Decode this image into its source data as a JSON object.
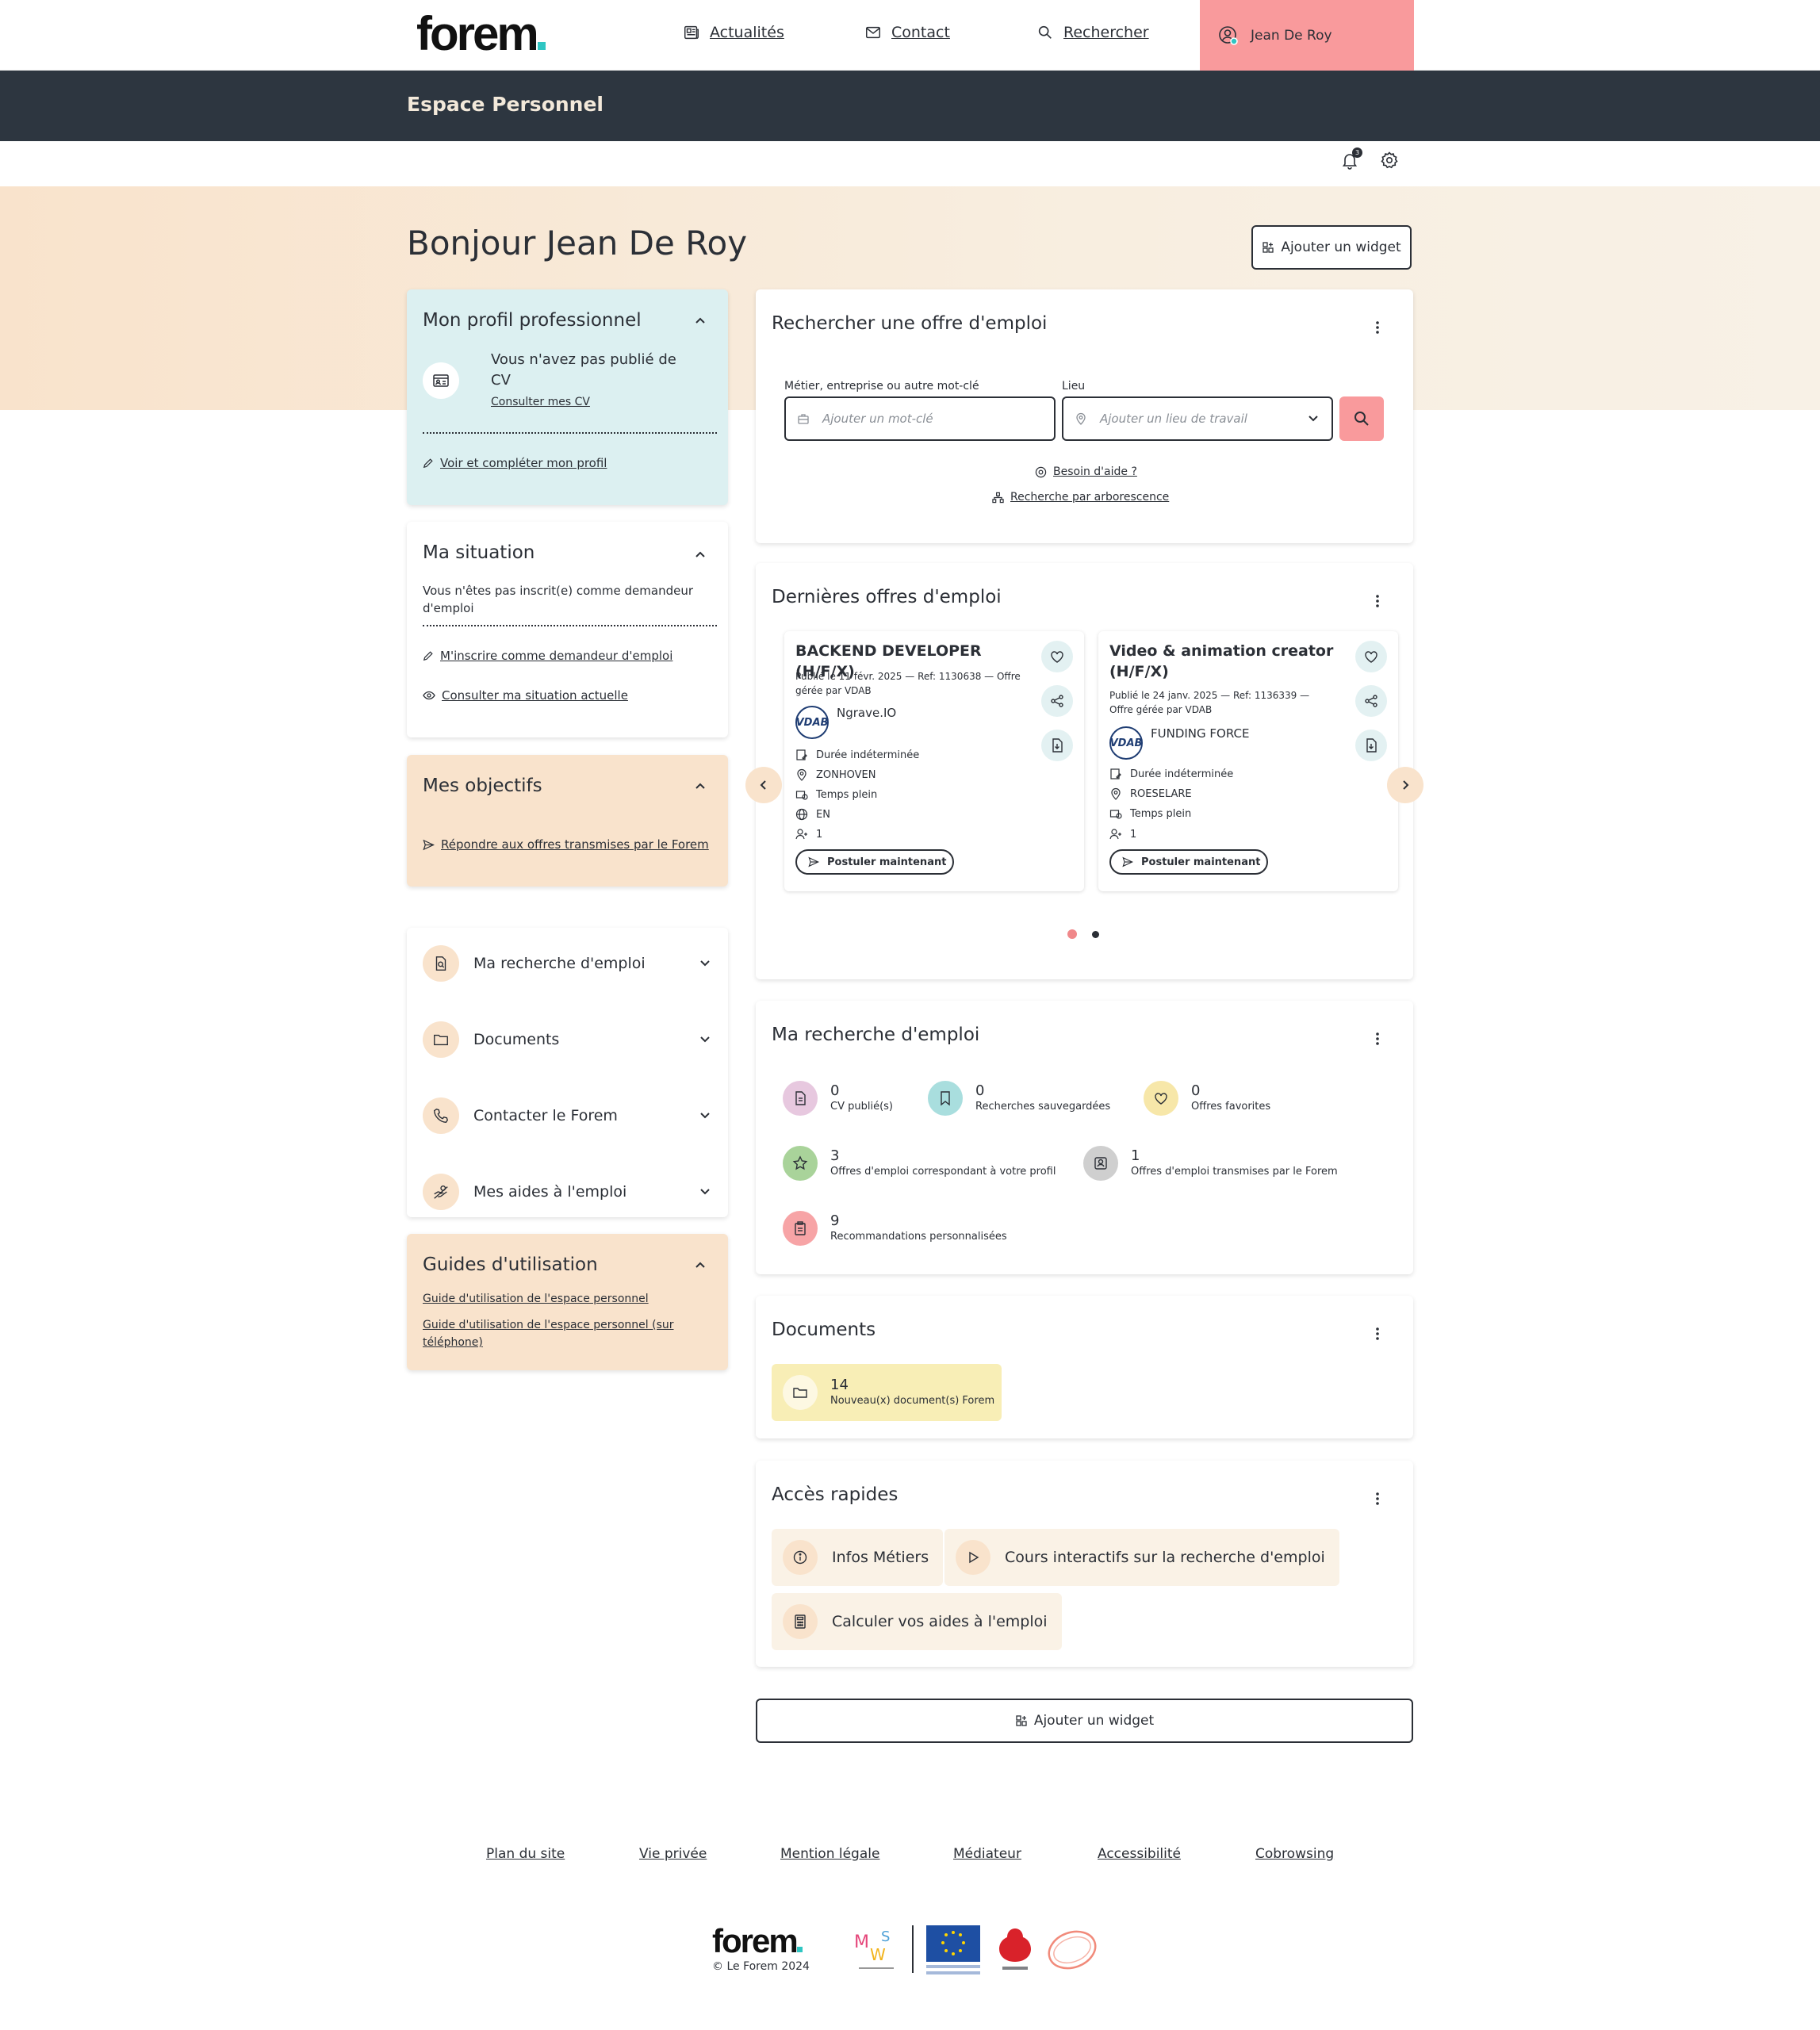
{
  "brand": {
    "logo_text": "forem",
    "accent": "#2fc6c3"
  },
  "nav": {
    "news": "Actualités",
    "contact": "Contact",
    "search": "Rechercher",
    "user": "Jean De Roy"
  },
  "header": {
    "title": "Espace Personnel",
    "notification_count": "3"
  },
  "greeting": "Bonjour Jean De Roy",
  "add_widget": "Ajouter un widget",
  "profile": {
    "title": "Mon profil professionnel",
    "no_cv": "Vous n'avez pas publié de CV",
    "consult_cv": "Consulter mes CV",
    "complete_profile": "Voir et compléter mon profil"
  },
  "situation": {
    "title": "Ma situation",
    "text": "Vous n'êtes pas inscrit(e) comme demandeur d'emploi",
    "register": "M'inscrire comme demandeur d'emploi",
    "consult": "Consulter ma situation actuelle"
  },
  "objectives": {
    "title": "Mes objectifs",
    "link": "Répondre aux offres transmises par le Forem"
  },
  "accordion": [
    {
      "label": "Ma recherche d'emploi",
      "icon": "document-search-icon"
    },
    {
      "label": "Documents",
      "icon": "folder-icon"
    },
    {
      "label": "Contacter le Forem",
      "icon": "phone-icon"
    },
    {
      "label": "Mes aides à l'emploi",
      "icon": "hand-coin-icon"
    }
  ],
  "guides": {
    "title": "Guides d'utilisation",
    "links": [
      "Guide d'utilisation de l'espace personnel",
      "Guide d'utilisation de l'espace personnel (sur téléphone)"
    ]
  },
  "job_search": {
    "title": "Rechercher une offre d'emploi",
    "keyword_label": "Métier, entreprise ou autre mot-clé",
    "keyword_placeholder": "Ajouter un mot-clé",
    "location_label": "Lieu",
    "location_placeholder": "Ajouter un lieu de travail",
    "help": "Besoin d'aide ?",
    "tree": "Recherche par arborescence"
  },
  "latest_offers": {
    "title": "Dernières offres d'emploi",
    "apply": "Postuler maintenant",
    "offers": [
      {
        "title": "BACKEND DEVELOPER (H/F/X)",
        "meta": "Publié le 11 févr. 2025 — Ref: 1130638 — Offre gérée par VDAB",
        "company": "Ngrave.IO",
        "logo": "VDAB",
        "duration": "Durée indéterminée",
        "location": "ZONHOVEN",
        "schedule": "Temps plein",
        "language": "EN",
        "positions": "1"
      },
      {
        "title": "Video & animation creator (H/F/X)",
        "meta": "Publié le 24 janv. 2025 — Ref: 1136339 — Offre gérée par VDAB",
        "company": "FUNDING FORCE",
        "logo": "VDAB",
        "duration": "Durée indéterminée",
        "location": "ROESELARE",
        "schedule": "Temps plein",
        "positions": "1"
      }
    ]
  },
  "my_search": {
    "title": "Ma recherche d'emploi",
    "stats": [
      {
        "num": "0",
        "label": "CV publié(s)",
        "bg": "#f6e6f1",
        "icbg": "#e7c8df"
      },
      {
        "num": "0",
        "label": "Recherches sauvegardées",
        "bg": "#e1f1f2",
        "icbg": "#a9dede"
      },
      {
        "num": "0",
        "label": "Offres favorites",
        "bg": "#fdf6e3",
        "icbg": "#f7e7a9"
      },
      {
        "num": "3",
        "label": "Offres d'emploi correspondant à votre profil",
        "bg": "#e5f2df",
        "icbg": "#a9d39a"
      },
      {
        "num": "1",
        "label": "Offres d'emploi transmises par le Forem",
        "bg": "#ececec",
        "icbg": "#cfcfcf"
      },
      {
        "num": "9",
        "label": "Recommandations personnalisées",
        "bg": "#fbd9d9",
        "icbg": "#f7a4a6"
      }
    ]
  },
  "documents": {
    "title": "Documents",
    "num": "14",
    "label": "Nouveau(x) document(s) Forem"
  },
  "quick_access": {
    "title": "Accès rapides",
    "items": [
      "Infos Métiers",
      "Cours interactifs sur la recherche d'emploi",
      "Calculer vos aides à l'emploi"
    ]
  },
  "footer": {
    "links": [
      "Plan du site",
      "Vie privée",
      "Mention légale",
      "Médiateur",
      "Accessibilité",
      "Cobrowsing"
    ],
    "copyright": "© Le Forem 2024",
    "partners": [
      "MWS",
      "Union européenne",
      "Wallonie",
      "synerjob"
    ]
  }
}
